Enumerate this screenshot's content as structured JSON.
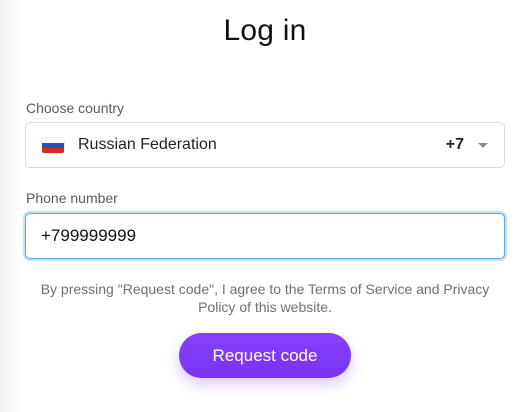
{
  "title": "Log in",
  "country": {
    "label": "Choose country",
    "selected_name": "Russian Federation",
    "selected_code": "+7",
    "flag_icon": "flag-russia"
  },
  "phone": {
    "label": "Phone number",
    "value": "+799999999"
  },
  "terms_text": "By pressing \"Request code\", I agree to the Terms of Service and Privacy Policy of this website.",
  "request_button_label": "Request code",
  "colors": {
    "accent": "#7c3aed",
    "focus_ring": "#5aa9d6"
  }
}
